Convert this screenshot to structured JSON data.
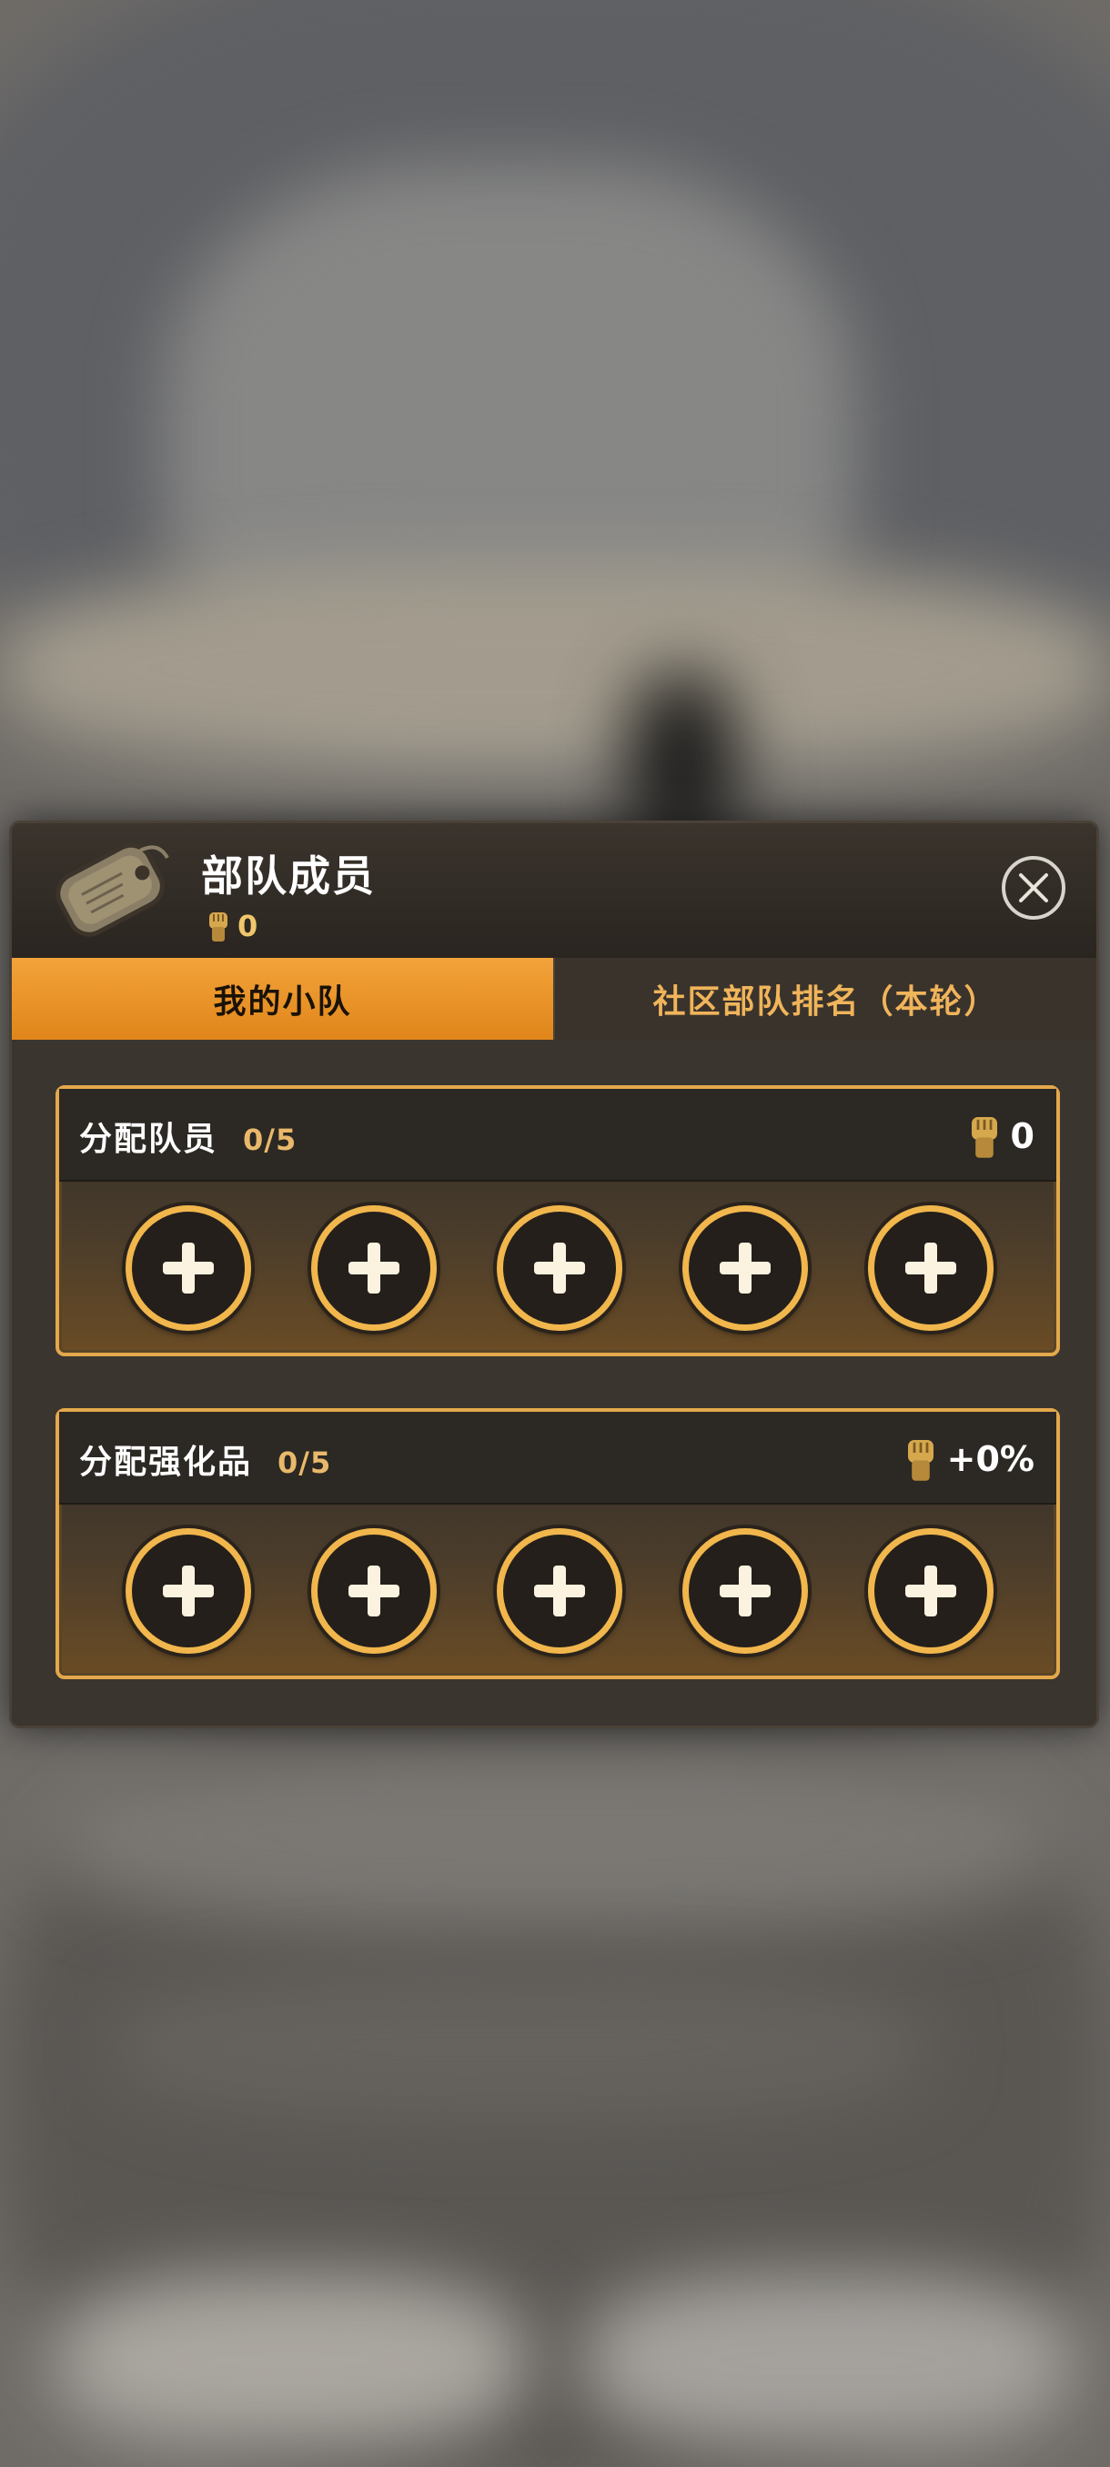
{
  "modal": {
    "title": "部队成员",
    "power_value": "0",
    "close_icon": "close-icon"
  },
  "tabs": [
    {
      "label": "我的小队",
      "active": true
    },
    {
      "label": "社区部队排名（本轮）",
      "active": false
    }
  ],
  "sections": [
    {
      "label": "分配队员",
      "count": "0/5",
      "right_value": "0",
      "right_icon": "fist-icon",
      "slots": 5,
      "slot_icon": "plus-icon"
    },
    {
      "label": "分配强化品",
      "count": "0/5",
      "right_value": "+0%",
      "right_icon": "fist-icon",
      "slots": 5,
      "slot_icon": "plus-icon"
    }
  ],
  "colors": {
    "accent": "#e0851a",
    "gold": "#f1b64c",
    "panel_bg": "#2a2622"
  }
}
